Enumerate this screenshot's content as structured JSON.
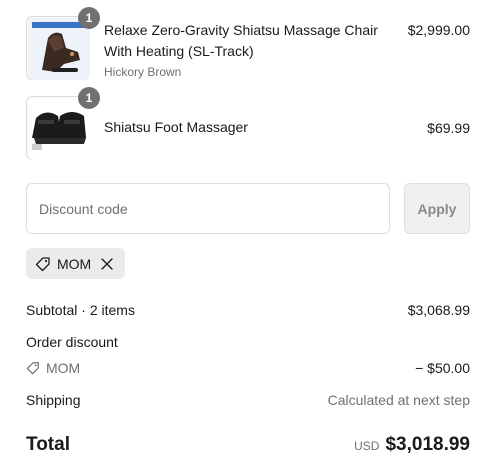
{
  "line_items": [
    {
      "quantity": "1",
      "title": "Relaxe Zero-Gravity Shiatsu Massage Chair With Heating (SL-Track)",
      "variant": "Hickory Brown",
      "price": "$2,999.00",
      "thumbnail_icon": "massage-chair-image"
    },
    {
      "quantity": "1",
      "title": "Shiatsu Foot Massager",
      "variant": "",
      "price": "$69.99",
      "thumbnail_icon": "foot-massager-image"
    }
  ],
  "discount": {
    "placeholder": "Discount code",
    "value": "",
    "apply_label": "Apply",
    "applied_code": "MOM"
  },
  "summary": {
    "subtotal_label": "Subtotal · 2 items",
    "subtotal_value": "$3,068.99",
    "order_discount_label": "Order discount",
    "order_discount_code": "MOM",
    "order_discount_value": "− $50.00",
    "shipping_label": "Shipping",
    "shipping_value": "Calculated at next step",
    "total_label": "Total",
    "total_currency": "USD",
    "total_value": "$3,018.99"
  },
  "colors": {
    "badge": "#707070",
    "muted_text": "#707070",
    "border": "#dedede",
    "chip_bg": "#ebebeb"
  }
}
